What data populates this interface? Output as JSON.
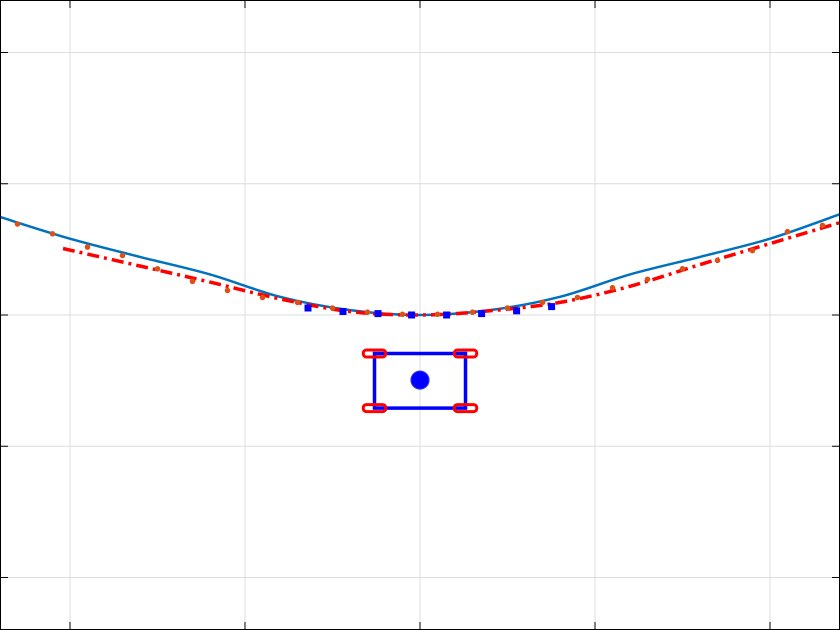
{
  "colors": {
    "background": "#ffffff",
    "grid": "#dcdcdc",
    "axes": "#000000",
    "reference_path": "#0072bd",
    "reference_markers": "#d95319",
    "predicted_path": "#ff0000",
    "vehicle_body": "#0000ff",
    "vehicle_wheels": "#ff0000",
    "horizon_points": "#0000ff"
  },
  "chart_data": {
    "type": "scatter",
    "title": "",
    "xlabel": "",
    "ylabel": "",
    "xlim": [
      -6,
      6
    ],
    "ylim": [
      -4.5,
      4.5
    ],
    "grid": true,
    "legend": "none",
    "x_ticks": [
      -5,
      -2.5,
      0,
      2.5,
      5
    ],
    "y_ticks": [
      -3.75,
      -1.875,
      0,
      1.875,
      3.75
    ],
    "series": [
      {
        "kind": "line",
        "x": [
          -6.0,
          -5.0,
          -4.0,
          -3.0,
          -2.0,
          -1.0,
          0.0,
          1.0,
          2.0,
          3.0,
          4.0,
          5.0,
          6.0
        ],
        "y": [
          1.4,
          1.09,
          0.83,
          0.58,
          0.26,
          0.07,
          0.0,
          0.07,
          0.26,
          0.58,
          0.83,
          1.09,
          1.44
        ]
      },
      {
        "kind": "points",
        "x": [
          -5.75,
          -5.25,
          -4.75,
          -4.25,
          -3.75,
          -3.25,
          -2.75,
          -2.25,
          -1.75,
          -1.25,
          -0.75,
          -0.25,
          0.25,
          0.75,
          1.25,
          1.75,
          2.25,
          2.75,
          3.25,
          3.75,
          4.25,
          4.75,
          5.25,
          5.75
        ],
        "y": [
          1.3,
          1.16,
          0.97,
          0.85,
          0.66,
          0.48,
          0.35,
          0.25,
          0.18,
          0.1,
          0.04,
          0.01,
          0.01,
          0.04,
          0.1,
          0.18,
          0.25,
          0.39,
          0.51,
          0.66,
          0.78,
          0.92,
          1.19,
          1.28
        ]
      },
      {
        "kind": "dashed-line",
        "x": [
          -5.1,
          -4.0,
          -3.0,
          -2.0,
          -1.0,
          0.0,
          1.0,
          2.0,
          3.0,
          4.0,
          5.0,
          6.0
        ],
        "y": [
          0.95,
          0.7,
          0.47,
          0.23,
          0.05,
          0.0,
          0.06,
          0.18,
          0.41,
          0.72,
          1.02,
          1.32
        ]
      },
      {
        "kind": "squares",
        "x": [
          -1.6,
          -1.1,
          -0.6,
          -0.12,
          0.38,
          0.88,
          1.38,
          1.88
        ],
        "y": [
          0.1,
          0.05,
          0.02,
          0.0,
          0.0,
          0.02,
          0.06,
          0.12
        ]
      }
    ],
    "vehicle": {
      "center": [
        0,
        -0.93
      ],
      "body": {
        "x_min": -0.65,
        "x_max": 0.65,
        "y_min": -1.33,
        "y_max": -0.55
      },
      "wheels": [
        [
          -0.65,
          -0.55
        ],
        [
          0.65,
          -0.55
        ],
        [
          -0.65,
          -1.33
        ],
        [
          0.65,
          -1.33
        ]
      ],
      "wheel_size": [
        0.32,
        0.1
      ],
      "center_radius": 0.13
    }
  }
}
